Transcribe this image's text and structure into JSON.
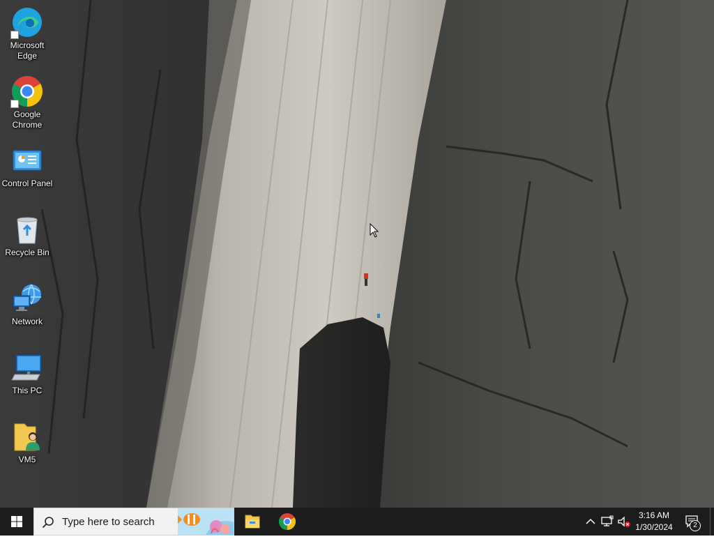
{
  "desktop_icons": [
    {
      "id": "edge",
      "label": "Microsoft Edge",
      "icon": "edge-icon",
      "shortcut": true
    },
    {
      "id": "chrome",
      "label": "Google Chrome",
      "icon": "chrome-icon",
      "shortcut": true
    },
    {
      "id": "control-panel",
      "label": "Control Panel",
      "icon": "control-panel-icon",
      "shortcut": false
    },
    {
      "id": "recycle-bin",
      "label": "Recycle Bin",
      "icon": "recycle-bin-icon",
      "shortcut": false
    },
    {
      "id": "network",
      "label": "Network",
      "icon": "network-icon",
      "shortcut": false
    },
    {
      "id": "this-pc",
      "label": "This PC",
      "icon": "this-pc-icon",
      "shortcut": false
    },
    {
      "id": "vm5",
      "label": "VM5",
      "icon": "user-folder-icon",
      "shortcut": false
    }
  ],
  "taskbar": {
    "search_placeholder": "Type here to search",
    "pinned_apps": [
      {
        "id": "file-explorer",
        "icon": "file-explorer-icon"
      },
      {
        "id": "chrome",
        "icon": "chrome-icon"
      }
    ],
    "tray": {
      "show_hidden_icon": "chevron-up-icon",
      "network_icon": "network-tray-icon",
      "volume_icon": "volume-muted-icon"
    },
    "clock": {
      "time": "3:16 AM",
      "date": "1/30/2024"
    },
    "notifications": {
      "icon": "action-center-icon",
      "count": "2"
    }
  },
  "colors": {
    "taskbar_bg": "#1c1c1c",
    "search_bg": "#f2f2f2",
    "windows_blue": "#0078d7"
  }
}
